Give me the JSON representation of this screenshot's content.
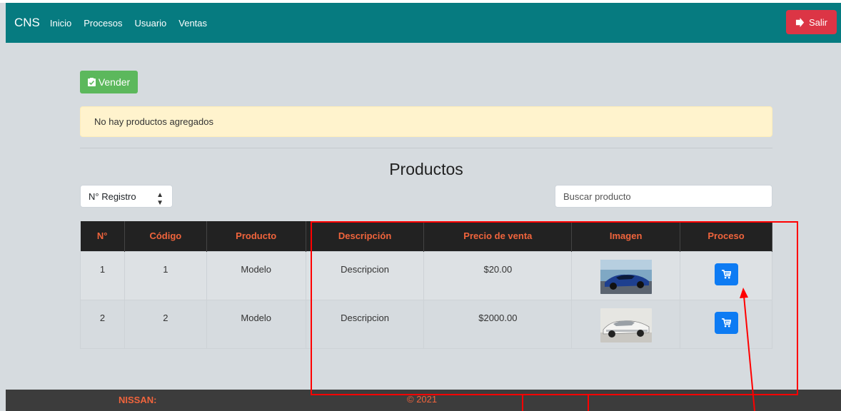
{
  "navbar": {
    "brand": "CNS",
    "links": [
      "Inicio",
      "Procesos",
      "Usuario",
      "Ventas"
    ],
    "logout_label": "Salir",
    "color": "#067b80"
  },
  "actions": {
    "sell_label": "Vender"
  },
  "alert": {
    "message": "No hay productos agregados"
  },
  "page": {
    "title": "Productos"
  },
  "filter": {
    "select_value": "N° Registro"
  },
  "search": {
    "placeholder": "Buscar producto"
  },
  "table": {
    "headers": [
      "N°",
      "Código",
      "Producto",
      "Descripción",
      "Precio de venta",
      "Imagen",
      "Proceso"
    ],
    "rows": [
      {
        "num": "1",
        "code": "1",
        "product": "Modelo",
        "description": "Descripcion",
        "price": "$20.00",
        "image": "blue-sports-car-photo"
      },
      {
        "num": "2",
        "code": "2",
        "product": "Modelo",
        "description": "Descripcion",
        "price": "$2000.00",
        "image": "classic-white-car-photo"
      }
    ]
  },
  "footer": {
    "brand": "NISSAN:",
    "copyright": "© 2021"
  },
  "icons": {
    "logout": "sign-out-icon",
    "sell": "clipboard-check-icon",
    "cart": "cart-icon"
  },
  "colors": {
    "header_text": "#f0643c",
    "danger": "#dc3545",
    "success": "#5cb85c",
    "primary": "#0d7bf3",
    "annotation": "#ff0000"
  }
}
